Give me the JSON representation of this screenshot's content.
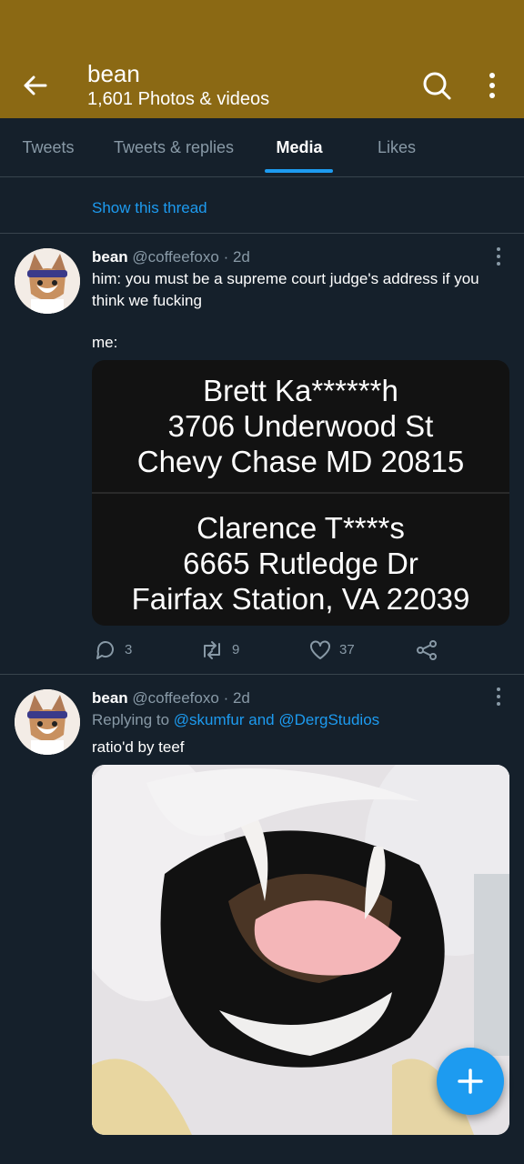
{
  "header": {
    "title": "bean",
    "subtitle": "1,601 Photos & videos",
    "back_icon": "arrow-left-icon",
    "search_icon": "search-icon",
    "more_icon": "more-vertical-icon",
    "background": "#8b6914"
  },
  "tabs": [
    {
      "label": "Tweets",
      "active": false
    },
    {
      "label": "Tweets & replies",
      "active": false
    },
    {
      "label": "Media",
      "active": true
    },
    {
      "label": "Likes",
      "active": false
    }
  ],
  "show_thread": "Show this thread",
  "tweets": [
    {
      "name": "bean",
      "handle": "@coffeefoxo",
      "separator": "·",
      "time": "2d",
      "text_line1": "him: you must be a supreme court judge's address if you think we fucking",
      "text_line2": "me:",
      "image_blocks": [
        {
          "lines": [
            "Brett Ka******h",
            "3706 Underwood St",
            "Chevy Chase MD 20815"
          ]
        },
        {
          "lines": [
            "Clarence T****s",
            "6665 Rutledge Dr",
            "Fairfax Station, VA 22039"
          ]
        }
      ],
      "actions": {
        "replies": "3",
        "retweets": "9",
        "likes": "37"
      }
    },
    {
      "name": "bean",
      "handle": "@coffeefoxo",
      "separator": "·",
      "time": "2d",
      "replying_prefix": "Replying to",
      "replying_mention1": "@skumfur",
      "replying_and": "and",
      "replying_mention2": "@DergStudios",
      "text": "ratio'd by teef"
    }
  ],
  "fab": {
    "icon": "plus-icon",
    "color": "#1d9bf0"
  },
  "colors": {
    "background": "#15202b",
    "accent": "#1d9bf0",
    "muted": "#8899a6",
    "divider": "#38444d"
  }
}
